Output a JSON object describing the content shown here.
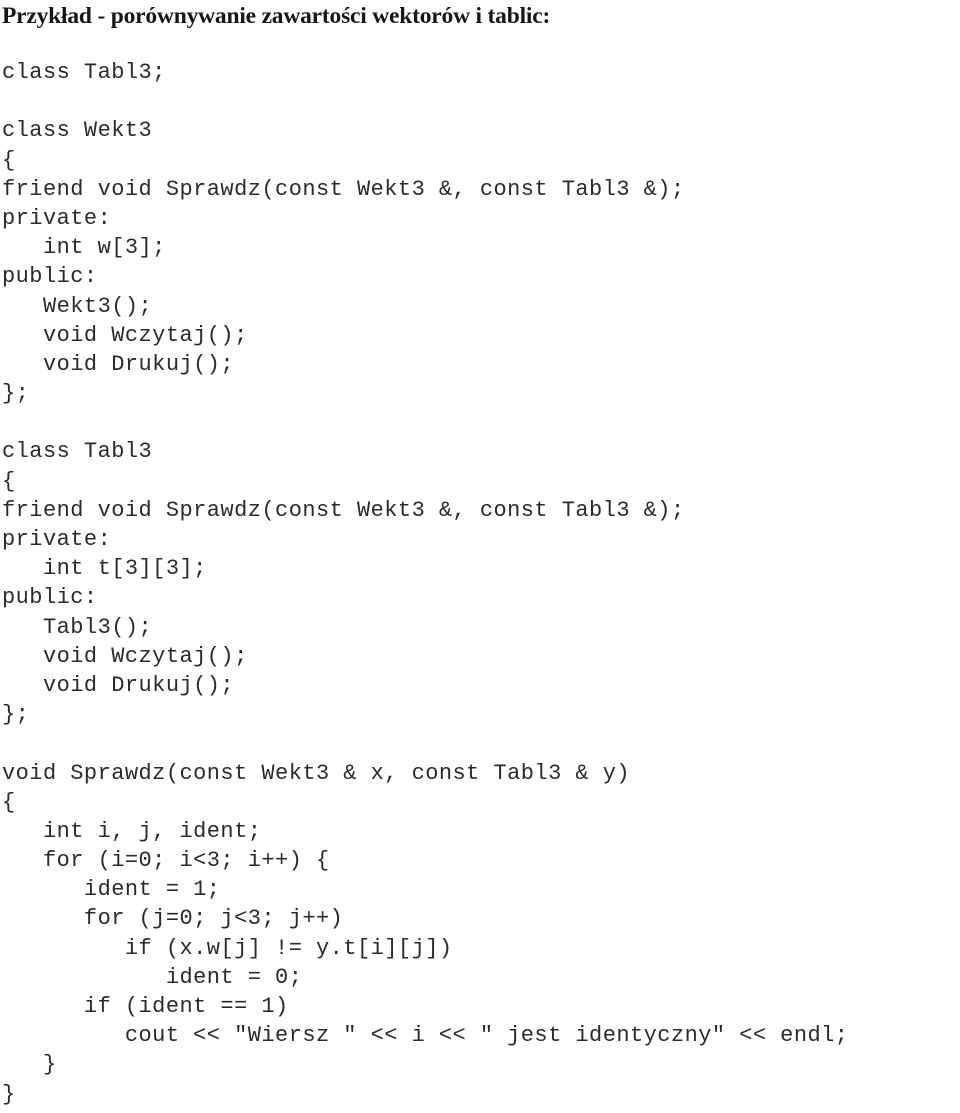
{
  "document": {
    "title": "Przykład - porównywanie zawartości wektorów i tablic:",
    "language": "pl",
    "background_color": "#ffffff",
    "title_color": "#17171a",
    "code_color": "#2b2b2f",
    "code_language": "C++"
  },
  "code": {
    "lines": [
      "class Tabl3;",
      "",
      "class Wekt3",
      "{",
      "friend void Sprawdz(const Wekt3 &, const Tabl3 &);",
      "private:",
      "   int w[3];",
      "public:",
      "   Wekt3();",
      "   void Wczytaj();",
      "   void Drukuj();",
      "};",
      "",
      "class Tabl3",
      "{",
      "friend void Sprawdz(const Wekt3 &, const Tabl3 &);",
      "private:",
      "   int t[3][3];",
      "public:",
      "   Tabl3();",
      "   void Wczytaj();",
      "   void Drukuj();",
      "};",
      "",
      "void Sprawdz(const Wekt3 & x, const Tabl3 & y)",
      "{",
      "   int i, j, ident;",
      "   for (i=0; i<3; i++) {",
      "      ident = 1;",
      "      for (j=0; j<3; j++)",
      "         if (x.w[j] != y.t[i][j])",
      "            ident = 0;",
      "      if (ident == 1)",
      "         cout << \"Wiersz \" << i << \" jest identyczny\" << endl;",
      "   }",
      "}"
    ]
  }
}
